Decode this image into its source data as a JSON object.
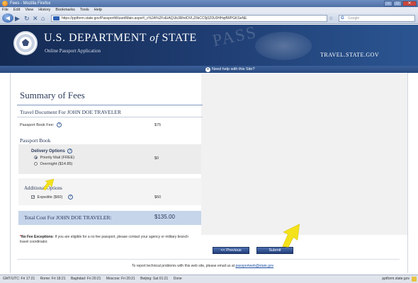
{
  "browser": {
    "title": "Fees - Mozilla Firefox",
    "menu": [
      "File",
      "Edit",
      "View",
      "History",
      "Bookmarks",
      "Tools",
      "Help"
    ],
    "url": "https://pptform.state.gov/PassportWizardMain.aspx#/_c%2A%2FvEiAQUb3RhdOVLZ6kCC5j0Z0U0HHqtfWPGKSeNE",
    "search_placeholder": "Google"
  },
  "header": {
    "dept_main": "U.S. DEPARTMENT",
    "dept_of": "of",
    "dept_state": "STATE",
    "subtitle": "Online Passport Application",
    "watermark": "PASS",
    "site": "TRAVEL.STATE.GOV",
    "help_link": "Need help with this Site?"
  },
  "page": {
    "title": "Summary of Fees",
    "travel_doc": "Travel Document For JOHN DOE TRAVELER",
    "passport_fee_label": "Passport Book Fee:",
    "passport_fee_value": "$75",
    "passport_book": "Passport Book",
    "delivery_label": "Delivery Options",
    "priority_label": "Priority Mail (FREE)",
    "priority_value": "$0",
    "overnight_label": "Overnight ($14.85)",
    "additional_label": "Additional Options",
    "expedite_label": "Expedite ($60)",
    "expedite_value": "$60",
    "total_label": "Total Cost For JOHN DOE TRAVELER:",
    "total_value": "$135.00",
    "note_bold": "No Fee Exceptions",
    "note_text": ": If you are eligible for a no fee passport, please contact your agency or military branch travel coordinator.",
    "previous_label": "<< Previous",
    "submit_label": "Submit",
    "footer_text": "To report technical problems with this web site, please email us at",
    "footer_email": "passportweb@state.gov"
  },
  "status": {
    "clocks": [
      "GMT/UTC: Fri 17:21",
      "Rome: Fri 18:21",
      "Baghdad: Fri 20:21",
      "Moscow: Fri 20:21",
      "Beijing: Sat 01:21",
      "Done"
    ],
    "domain": "pptform.state.gov"
  },
  "colors": {
    "highlight_arrow": "#f4e21a",
    "nav_blue": "#1f3d72"
  }
}
